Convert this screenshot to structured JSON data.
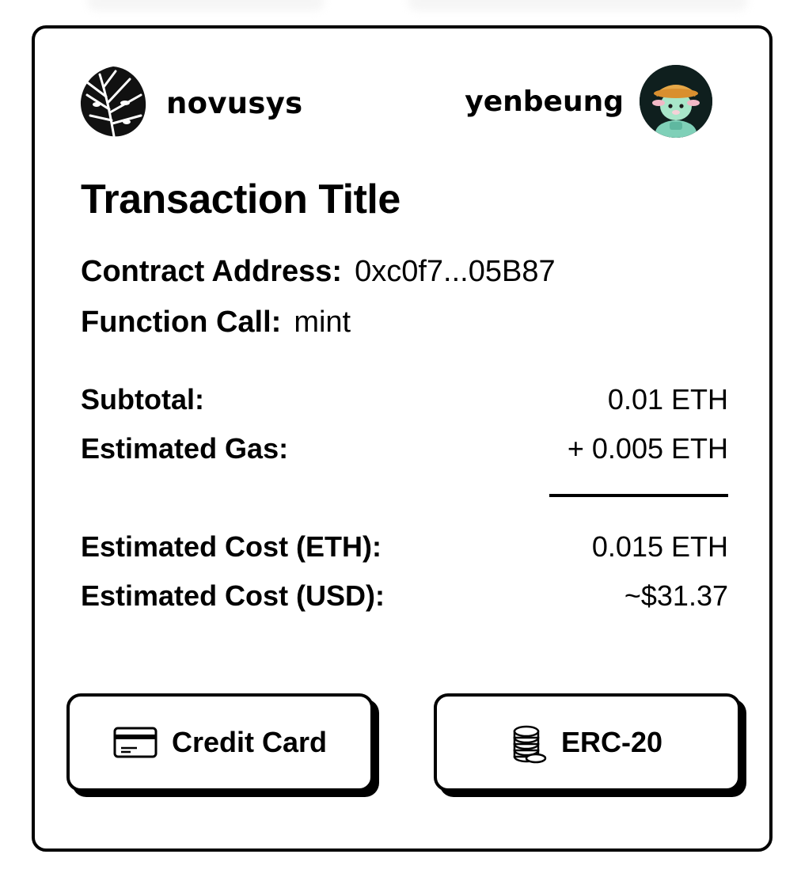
{
  "brand": {
    "name": "novusys",
    "icon": "monstera-leaf-logo"
  },
  "user": {
    "name": "yenbeung",
    "avatar": "avatar-sheep-character"
  },
  "transaction": {
    "title": "Transaction Title",
    "contract_label": "Contract Address:",
    "contract_value": "0xc0f7...05B87",
    "function_label": "Function Call:",
    "function_value": "mint"
  },
  "summary": {
    "subtotal_label": "Subtotal:",
    "subtotal_value": "0.01 ETH",
    "gas_label": "Estimated Gas:",
    "gas_value": "+ 0.005 ETH",
    "cost_eth_label": "Estimated Cost (ETH):",
    "cost_eth_value": "0.015 ETH",
    "cost_usd_label": "Estimated Cost (USD):",
    "cost_usd_value": "~$31.37"
  },
  "payment": {
    "credit_card": {
      "label": "Credit Card",
      "icon": "credit-card-icon"
    },
    "erc20": {
      "label": "ERC-20",
      "icon": "coin-stack-icon"
    }
  },
  "colors": {
    "border": "#000000",
    "background": "#ffffff"
  }
}
